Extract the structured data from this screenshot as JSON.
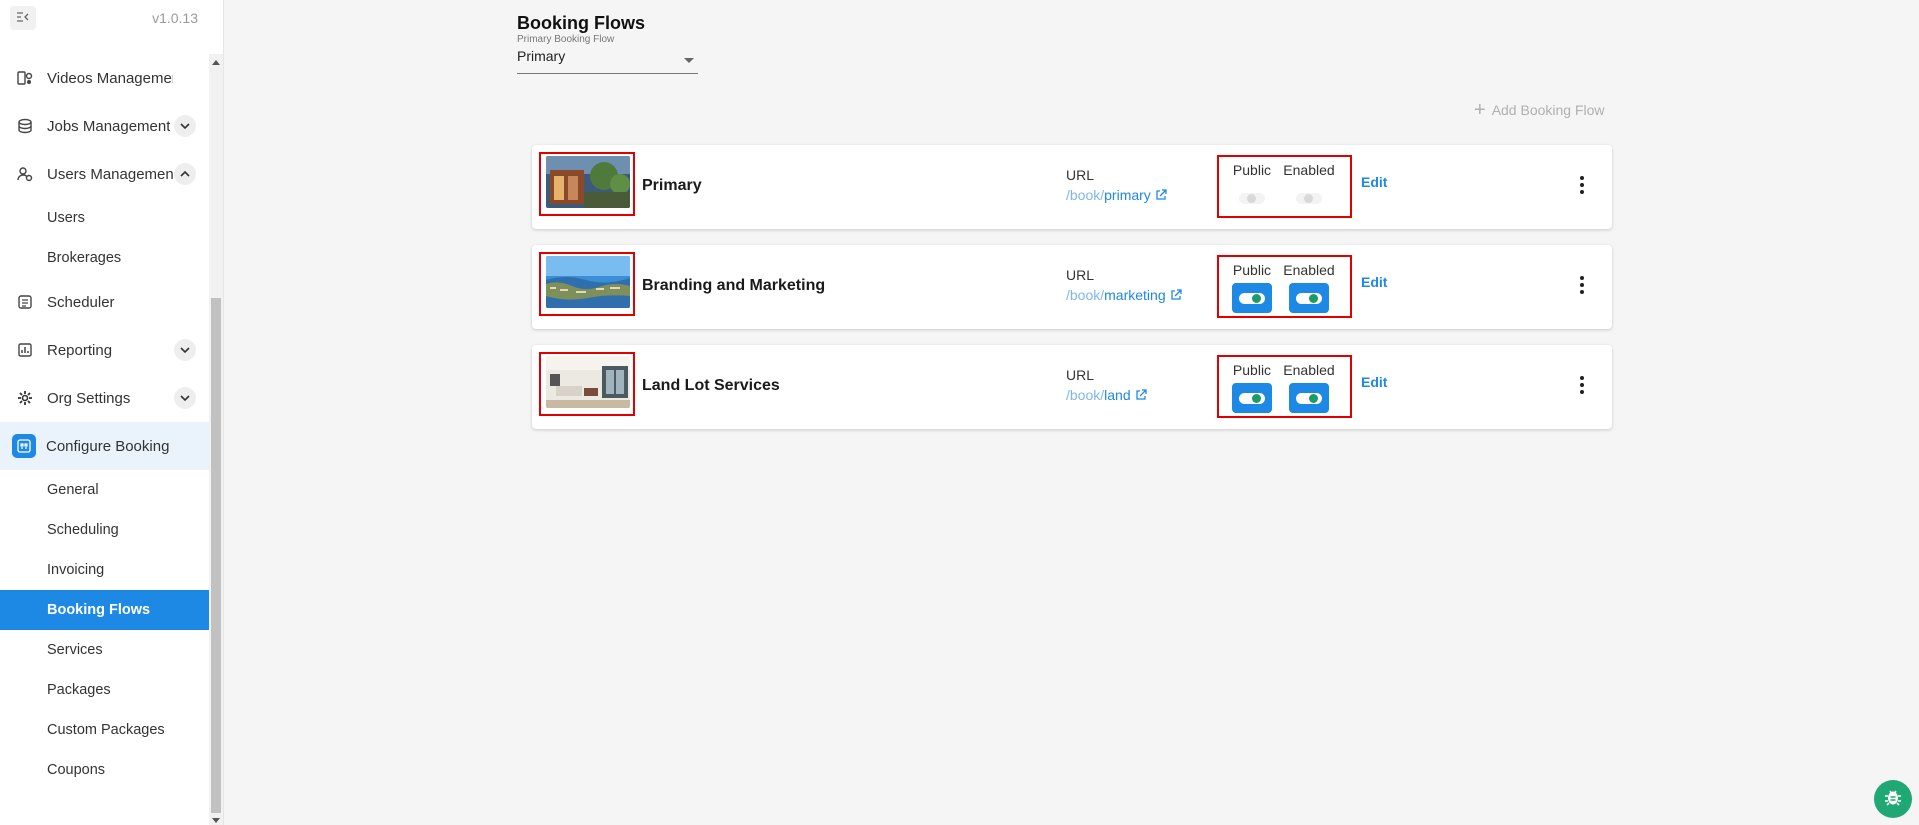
{
  "sidebar": {
    "version": "v1.0.13",
    "items": [
      {
        "label": "Videos Management",
        "icon": "video-icon",
        "expandable": false
      },
      {
        "label": "Jobs Management",
        "icon": "jobs-icon",
        "expandable": true,
        "expanded": false
      },
      {
        "label": "Users Management",
        "icon": "users-icon",
        "expandable": true,
        "expanded": true
      },
      {
        "label": "Users"
      },
      {
        "label": "Brokerages"
      },
      {
        "label": "Scheduler",
        "icon": "scheduler-icon"
      },
      {
        "label": "Reporting",
        "icon": "reporting-icon",
        "expandable": true
      },
      {
        "label": "Org Settings",
        "icon": "gear-icon",
        "expandable": true
      },
      {
        "label": "Configure Booking",
        "icon": "configure-booking-icon"
      }
    ],
    "configure_booking_sub": [
      {
        "label": "General"
      },
      {
        "label": "Scheduling"
      },
      {
        "label": "Invoicing"
      },
      {
        "label": "Booking Flows",
        "active": true
      },
      {
        "label": "Services"
      },
      {
        "label": "Packages"
      },
      {
        "label": "Custom Packages"
      },
      {
        "label": "Coupons"
      }
    ]
  },
  "header": {
    "title": "Booking Flows",
    "primary_select_label": "Primary Booking Flow",
    "primary_select_value": "Primary",
    "add_button": "Add Booking Flow"
  },
  "flows": [
    {
      "name": "Primary",
      "url_title": "URL",
      "url_prefix": "/book/",
      "slug": "primary",
      "public_label": "Public",
      "enabled_label": "Enabled",
      "public": false,
      "enabled": false,
      "disabled_state": true,
      "edit": "Edit"
    },
    {
      "name": "Branding and Marketing",
      "url_title": "URL",
      "url_prefix": "/book/",
      "slug": "marketing",
      "public_label": "Public",
      "enabled_label": "Enabled",
      "public": true,
      "enabled": true,
      "edit": "Edit"
    },
    {
      "name": "Land Lot Services",
      "url_title": "URL",
      "url_prefix": "/book/",
      "slug": "land",
      "public_label": "Public",
      "enabled_label": "Enabled",
      "public": true,
      "enabled": true,
      "edit": "Edit"
    }
  ],
  "colors": {
    "accent": "#1e88e5",
    "highlight_border": "#e00000",
    "toggle_knob": "#1a9c68",
    "bug_button": "#1fa774"
  }
}
